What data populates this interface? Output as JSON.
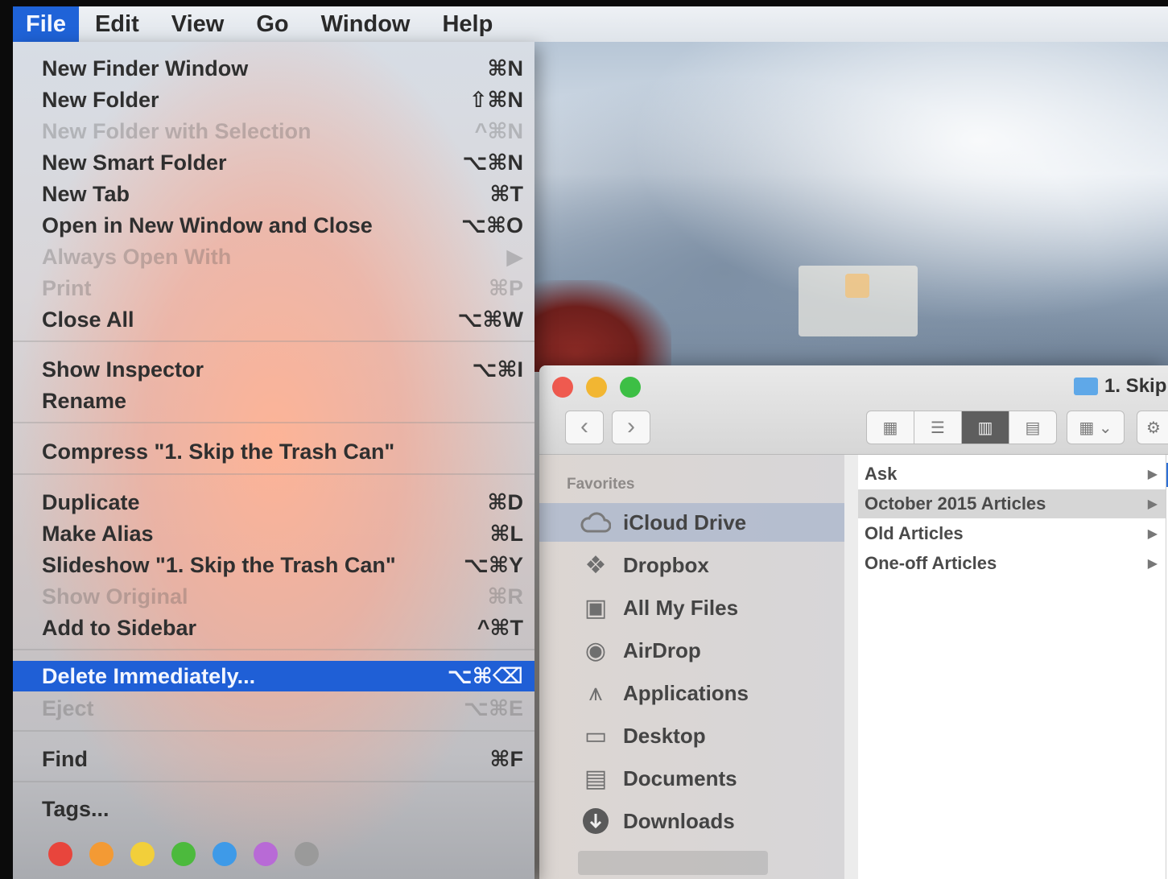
{
  "menubar": {
    "items": [
      "File",
      "Edit",
      "View",
      "Go",
      "Window",
      "Help"
    ],
    "active": "File"
  },
  "file_menu": {
    "items": [
      {
        "label": "New Finder Window",
        "shortcut": "⌘N",
        "enabled": true
      },
      {
        "label": "New Folder",
        "shortcut": "⇧⌘N",
        "enabled": true
      },
      {
        "label": "New Folder with Selection",
        "shortcut": "^⌘N",
        "enabled": false
      },
      {
        "label": "New Smart Folder",
        "shortcut": "⌥⌘N",
        "enabled": true
      },
      {
        "label": "New Tab",
        "shortcut": "⌘T",
        "enabled": true
      },
      {
        "label": "Open in New Window and Close",
        "shortcut": "⌥⌘O",
        "enabled": true
      },
      {
        "label": "Always Open With",
        "shortcut": "▶",
        "enabled": false
      },
      {
        "label": "Print",
        "shortcut": "⌘P",
        "enabled": false
      },
      {
        "label": "Close All",
        "shortcut": "⌥⌘W",
        "enabled": true
      },
      {
        "label": "Show Inspector",
        "shortcut": "⌥⌘I",
        "enabled": true
      },
      {
        "label": "Rename",
        "shortcut": "",
        "enabled": true
      },
      {
        "label": "Compress \"1. Skip the Trash Can\"",
        "shortcut": "",
        "enabled": true
      },
      {
        "label": "Duplicate",
        "shortcut": "⌘D",
        "enabled": true
      },
      {
        "label": "Make Alias",
        "shortcut": "⌘L",
        "enabled": true
      },
      {
        "label": "Slideshow \"1. Skip the Trash Can\"",
        "shortcut": "⌥⌘Y",
        "enabled": true
      },
      {
        "label": "Show Original",
        "shortcut": "⌘R",
        "enabled": false
      },
      {
        "label": "Add to Sidebar",
        "shortcut": "^⌘T",
        "enabled": true
      },
      {
        "label": "Delete Immediately...",
        "shortcut": "⌥⌘⌫",
        "enabled": true,
        "selected": true
      },
      {
        "label": "Eject",
        "shortcut": "⌥⌘E",
        "enabled": false
      },
      {
        "label": "Find",
        "shortcut": "⌘F",
        "enabled": true
      },
      {
        "label": "Tags...",
        "shortcut": "",
        "enabled": true
      }
    ],
    "tag_colors": [
      "#e8453c",
      "#f39a34",
      "#f2cf3a",
      "#4cba3d",
      "#3e9ae8",
      "#b86ad6",
      "#9a9a9a"
    ]
  },
  "finder": {
    "window_title": "1. Skip",
    "sidebar": {
      "heading": "Favorites",
      "items": [
        {
          "label": "iCloud Drive",
          "icon": "cloud-icon",
          "selected": true
        },
        {
          "label": "Dropbox",
          "icon": "dropbox-icon"
        },
        {
          "label": "All My Files",
          "icon": "all-my-files-icon"
        },
        {
          "label": "AirDrop",
          "icon": "airdrop-icon"
        },
        {
          "label": "Applications",
          "icon": "applications-icon"
        },
        {
          "label": "Desktop",
          "icon": "desktop-icon"
        },
        {
          "label": "Documents",
          "icon": "documents-icon"
        },
        {
          "label": "Downloads",
          "icon": "downloads-icon"
        }
      ]
    },
    "column1": [
      {
        "label": "Ask"
      },
      {
        "label": "October 2015 Articles",
        "highlighted": true
      },
      {
        "label": "Old Articles"
      },
      {
        "label": "One-off Articles"
      }
    ]
  }
}
